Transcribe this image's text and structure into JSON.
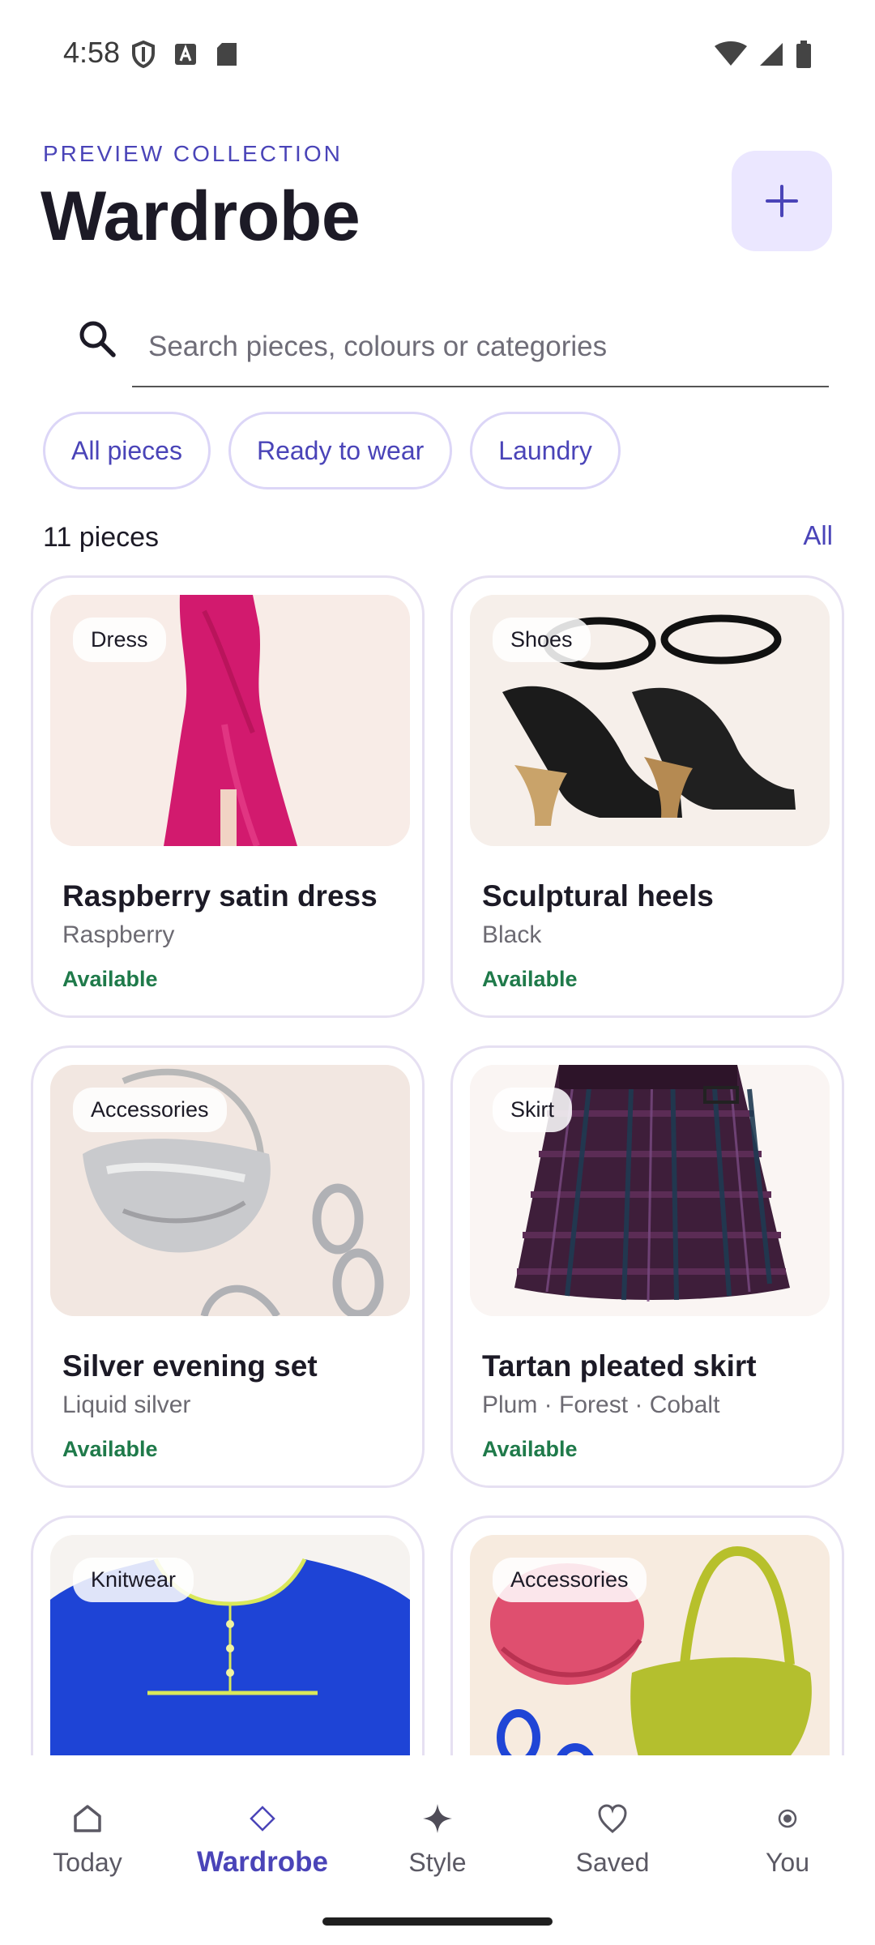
{
  "status_bar": {
    "time": "4:58"
  },
  "header": {
    "eyebrow": "PREVIEW COLLECTION",
    "title": "Wardrobe"
  },
  "search": {
    "placeholder": "Search pieces, colours or categories"
  },
  "filters": [
    "All pieces",
    "Ready to wear",
    "Laundry"
  ],
  "summary": {
    "count": "11 pieces",
    "all_link": "All"
  },
  "items": [
    {
      "badge": "Dress",
      "title": "Raspberry satin dress",
      "subtitle": "Raspberry",
      "status": "Available"
    },
    {
      "badge": "Shoes",
      "title": "Sculptural heels",
      "subtitle": "Black",
      "status": "Available"
    },
    {
      "badge": "Accessories",
      "title": "Silver evening set",
      "subtitle": "Liquid silver",
      "status": "Available"
    },
    {
      "badge": "Skirt",
      "title": "Tartan pleated skirt",
      "subtitle": "Plum · Forest · Cobalt",
      "status": "Available"
    },
    {
      "badge": "Knitwear"
    },
    {
      "badge": "Accessories"
    }
  ],
  "nav": [
    {
      "label": "Today",
      "icon": "home-icon"
    },
    {
      "label": "Wardrobe",
      "icon": "diamond-icon",
      "active": true
    },
    {
      "label": "Style",
      "icon": "sparkle-icon"
    },
    {
      "label": "Saved",
      "icon": "heart-icon"
    },
    {
      "label": "You",
      "icon": "profile-icon"
    }
  ],
  "colors": {
    "accent": "#4a44b8",
    "accent_container": "#ebe7ff",
    "available": "#1f7a4a",
    "card_border": "#e6e0f2"
  }
}
